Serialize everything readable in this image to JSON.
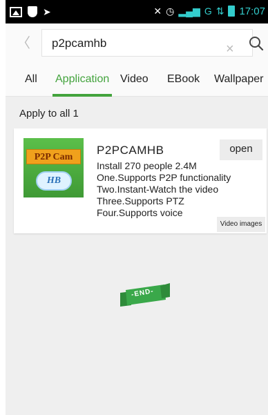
{
  "status_bar": {
    "time": "17:07",
    "network": "G",
    "icons": [
      "picture-icon",
      "shield-icon",
      "arrow-icon",
      "mute-icon",
      "alarm-icon",
      "signal-icon",
      "data-icon",
      "battery-icon"
    ]
  },
  "search": {
    "value": "p2pcamhb",
    "back_glyph": "〈",
    "clear_glyph": "×"
  },
  "tabs": [
    {
      "label": "All"
    },
    {
      "label": "Application",
      "active": true
    },
    {
      "label": "Video"
    },
    {
      "label": "EBook"
    },
    {
      "label": "Wallpaper"
    }
  ],
  "results": {
    "apply_all_label": "Apply to all 1"
  },
  "app": {
    "name": "P2PCAMHB",
    "install_info": "Install 270 people 2.4M",
    "features": [
      "One.Supports P2P functionality",
      "Two.Instant-Watch the video",
      "Three.Supports PTZ",
      "Four.Supports voice"
    ],
    "open_label": "open",
    "video_images_label": "Video images",
    "icon_banner_text": "P2P Cam",
    "icon_cloud_text": "HB"
  },
  "end_marker": {
    "text": "-END-"
  },
  "colors": {
    "accent_green": "#43a33d",
    "status_teal": "#33cccc",
    "background": "#efefef"
  }
}
